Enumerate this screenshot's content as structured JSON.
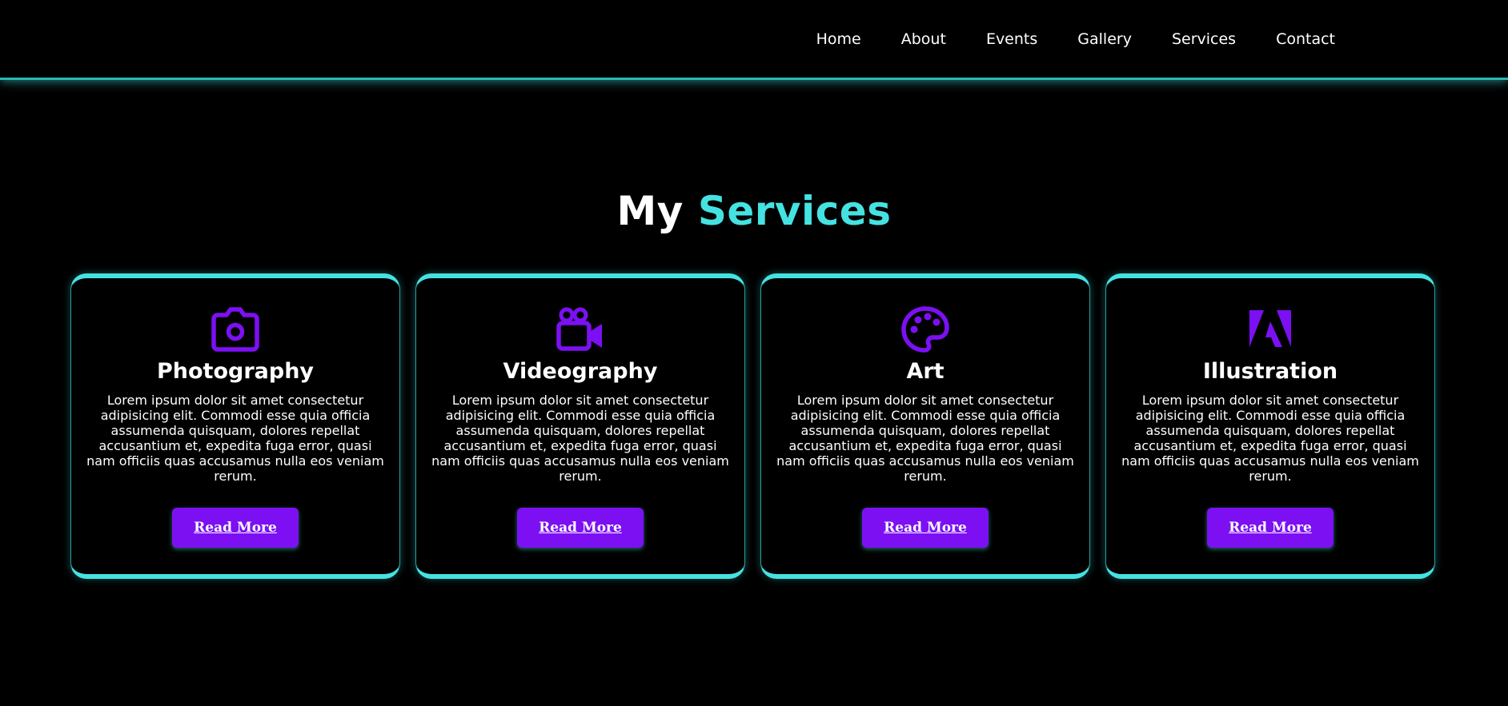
{
  "nav": {
    "items": [
      {
        "label": "Home"
      },
      {
        "label": "About"
      },
      {
        "label": "Events"
      },
      {
        "label": "Gallery"
      },
      {
        "label": "Services"
      },
      {
        "label": "Contact"
      }
    ]
  },
  "section": {
    "title_prefix": "My",
    "title_accent": "Services"
  },
  "colors": {
    "background": "#000000",
    "accent_cyan": "#45e2e2",
    "accent_purple": "#7c10f3",
    "text": "#ffffff"
  },
  "cards": [
    {
      "icon": "camera-icon",
      "title": "Photography",
      "text": "Lorem ipsum dolor sit amet consectetur adipisicing elit. Commodi esse quia officia assumenda quisquam, dolores repellat accusantium et, expedita fuga error, quasi nam officiis quas accusamus nulla eos veniam rerum.",
      "button": "Read More"
    },
    {
      "icon": "video-camera-icon",
      "title": "Videography",
      "text": "Lorem ipsum dolor sit amet consectetur adipisicing elit. Commodi esse quia officia assumenda quisquam, dolores repellat accusantium et, expedita fuga error, quasi nam officiis quas accusamus nulla eos veniam rerum.",
      "button": "Read More"
    },
    {
      "icon": "palette-icon",
      "title": "Art",
      "text": "Lorem ipsum dolor sit amet consectetur adipisicing elit. Commodi esse quia officia assumenda quisquam, dolores repellat accusantium et, expedita fuga error, quasi nam officiis quas accusamus nulla eos veniam rerum.",
      "button": "Read More"
    },
    {
      "icon": "adobe-icon",
      "title": "Illustration",
      "text": "Lorem ipsum dolor sit amet consectetur adipisicing elit. Commodi esse quia officia assumenda quisquam, dolores repellat accusantium et, expedita fuga error, quasi nam officiis quas accusamus nulla eos veniam rerum.",
      "button": "Read More"
    }
  ]
}
